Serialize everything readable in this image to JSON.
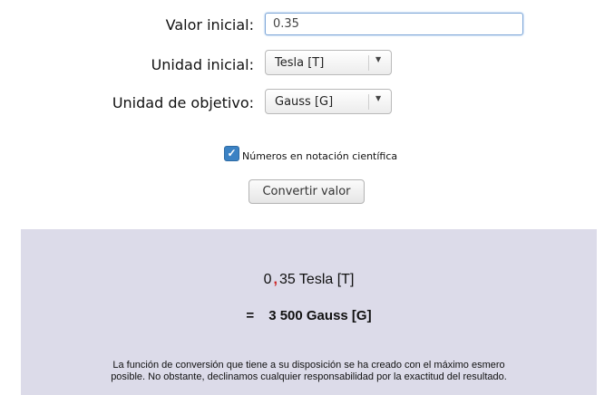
{
  "form": {
    "valor_label": "Valor inicial:",
    "valor_value": "0.35",
    "unidad_inicial_label": "Unidad inicial:",
    "unidad_inicial_value": "Tesla [T]",
    "unidad_objetivo_label": "Unidad de objetivo:",
    "unidad_objetivo_value": "Gauss [G]",
    "checkbox_label": "Números en notación científica",
    "checkbox_checked": true,
    "convert_button": "Convertir valor"
  },
  "result": {
    "from_int": "0",
    "from_sep": ",",
    "from_rest": "35 Tesla [T]",
    "equals": "=",
    "to_text": "3 500 Gauss [G]",
    "disclaimer_line1": "La función de conversión que tiene a su disposición se ha creado con el máximo esmero",
    "disclaimer_line2": "posible. No obstante, declinamos cualquier responsabilidad por la exactitud del resultado."
  },
  "colors": {
    "result_background": "#dcdbe9",
    "accent": "#3b82c4",
    "decimal_separator": "#cc2222"
  }
}
